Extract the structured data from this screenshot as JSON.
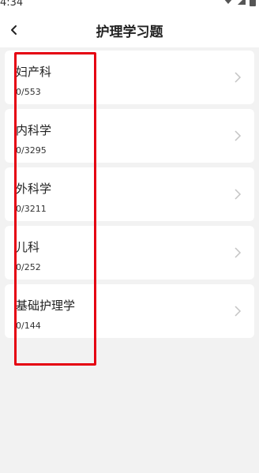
{
  "status": {
    "time": "4:34"
  },
  "header": {
    "title": "护理学习题"
  },
  "courses": [
    {
      "name": "妇产科",
      "progress": "0/553"
    },
    {
      "name": "内科学",
      "progress": "0/3295"
    },
    {
      "name": "外科学",
      "progress": "0/3211"
    },
    {
      "name": "儿科",
      "progress": "0/252"
    },
    {
      "name": "基础护理学",
      "progress": "0/144"
    }
  ],
  "colors": {
    "highlight": "#e50012",
    "background": "#f2f2f2"
  }
}
